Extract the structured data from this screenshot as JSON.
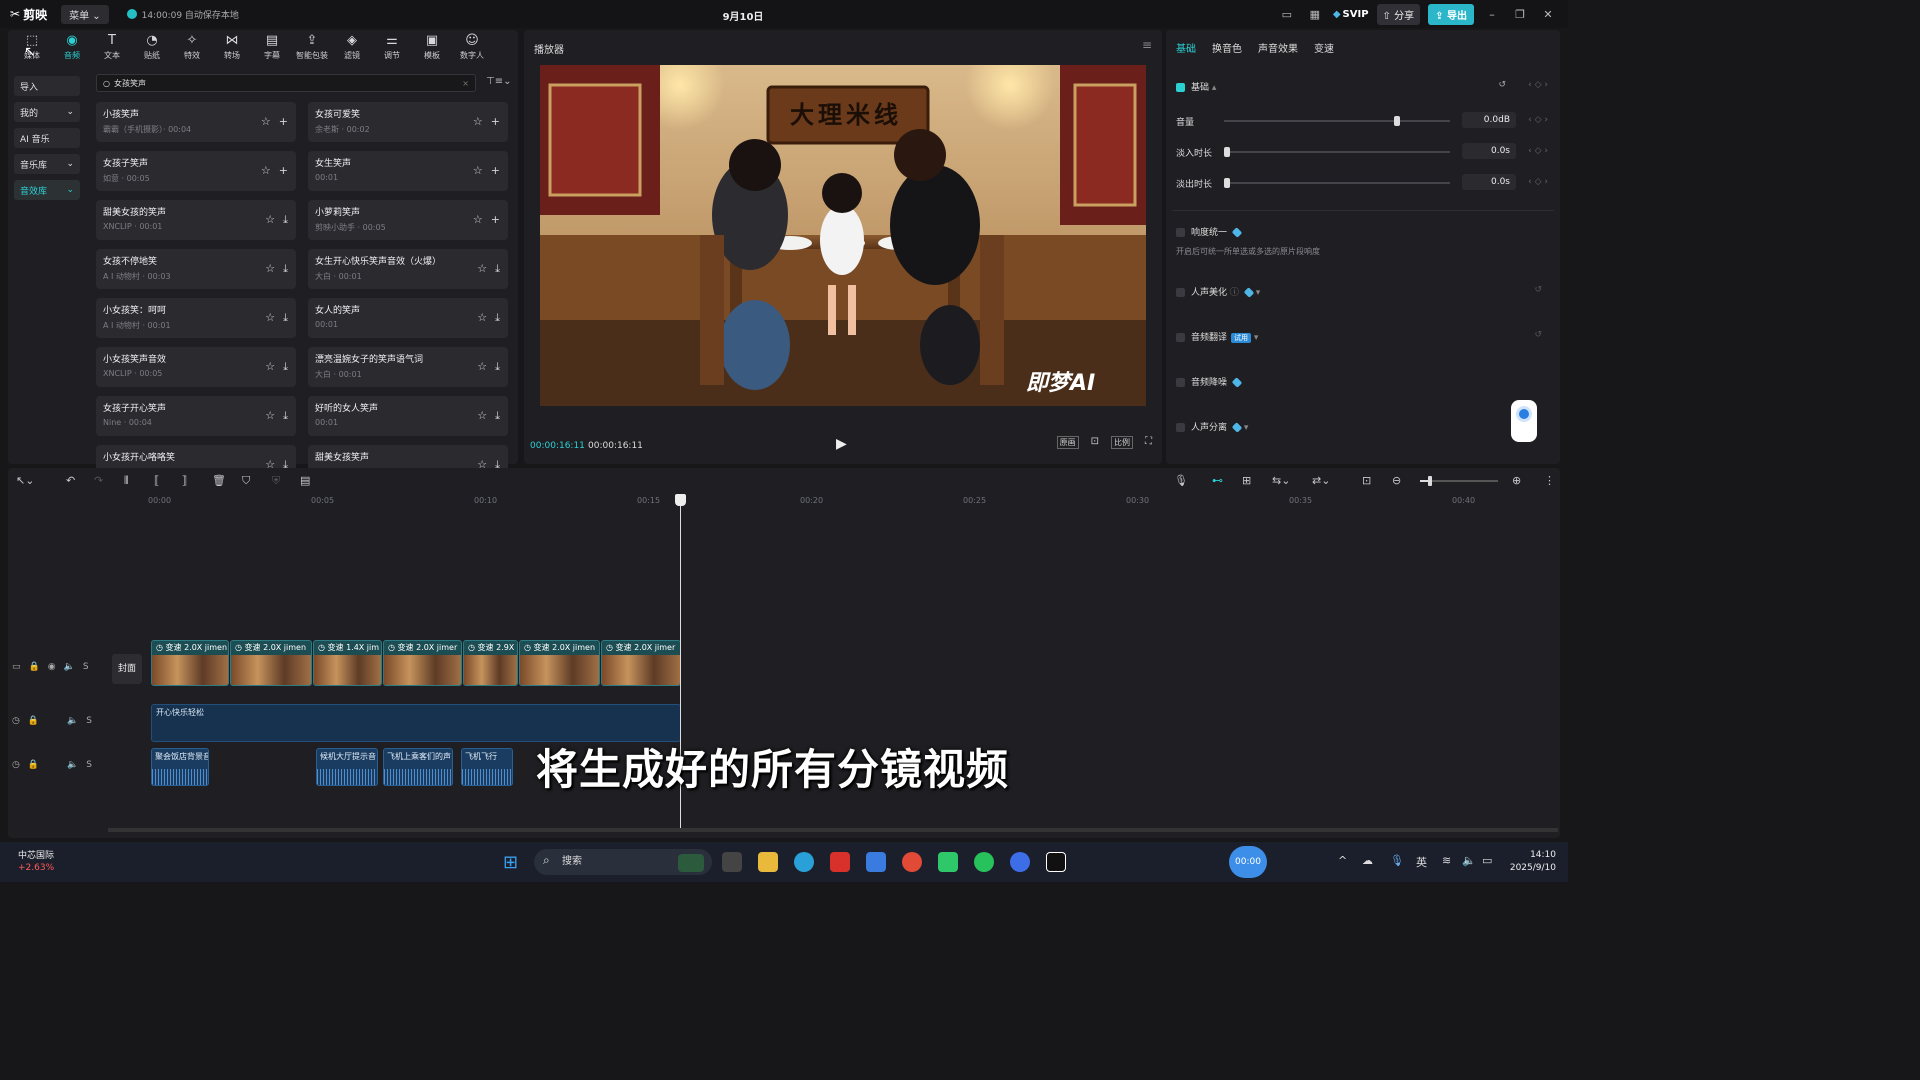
{
  "app": {
    "logo": "剪映",
    "menu": "菜单",
    "autosave": "14:00:09 自动保存本地",
    "date_title": "9月10日"
  },
  "topright": {
    "svip": "SVIP",
    "share": "分享",
    "export": "导出",
    "minimize": "–",
    "restore": "❐",
    "close": "✕"
  },
  "tools": [
    {
      "label": "媒体",
      "icon": "⬚"
    },
    {
      "label": "音频",
      "icon": "◉"
    },
    {
      "label": "文本",
      "icon": "T"
    },
    {
      "label": "贴纸",
      "icon": "◔"
    },
    {
      "label": "特效",
      "icon": "✧"
    },
    {
      "label": "转场",
      "icon": "⋈"
    },
    {
      "label": "字幕",
      "icon": "▤"
    },
    {
      "label": "智能包装",
      "icon": "⇪"
    },
    {
      "label": "滤镜",
      "icon": "◈"
    },
    {
      "label": "调节",
      "icon": "⚌"
    },
    {
      "label": "模板",
      "icon": "▣"
    },
    {
      "label": "数字人",
      "icon": "☺"
    }
  ],
  "sidebar": [
    {
      "label": "导入",
      "arrow": ""
    },
    {
      "label": "我的",
      "arrow": "⌄"
    },
    {
      "label": "AI 音乐",
      "arrow": ""
    },
    {
      "label": "音乐库",
      "arrow": "⌄"
    },
    {
      "label": "音效库",
      "arrow": "⌄"
    }
  ],
  "search": {
    "value": "女孩笑声",
    "clear": "×",
    "filter": "⊤≡⌄"
  },
  "cards": [
    {
      "title": "小孩笑声",
      "meta": "霸霸（手机摄影）· 00:04",
      "a2": "+"
    },
    {
      "title": "女孩可爱笑",
      "meta": "余老斯 · 00:02",
      "a2": "+"
    },
    {
      "title": "女孩子笑声",
      "meta": "如意 · 00:05",
      "a2": "+"
    },
    {
      "title": "女生笑声",
      "meta": "00:01",
      "a2": "+"
    },
    {
      "title": "甜美女孩的笑声",
      "meta": "XNCLIP · 00:01",
      "a2": "⤓"
    },
    {
      "title": "小萝莉笑声",
      "meta": "剪映小助手 · 00:05",
      "a2": "+"
    },
    {
      "title": "女孩不停地笑",
      "meta": "A I 动物村 · 00:03",
      "a2": "⤓"
    },
    {
      "title": "女生开心快乐笑声音效（火爆）",
      "meta": "大白 · 00:01",
      "a2": "⤓"
    },
    {
      "title": "小女孩笑：呵呵",
      "meta": "A I 动物村 · 00:01",
      "a2": "⤓"
    },
    {
      "title": "女人的笑声",
      "meta": "00:01",
      "a2": "⤓"
    },
    {
      "title": "小女孩笑声音效",
      "meta": "XNCLIP · 00:05",
      "a2": "⤓"
    },
    {
      "title": "漂亮温婉女子的笑声语气词",
      "meta": "大白 · 00:01",
      "a2": "⤓"
    },
    {
      "title": "女孩子开心笑声",
      "meta": "Nine · 00:04",
      "a2": "⤓"
    },
    {
      "title": "好听的女人笑声",
      "meta": "00:01",
      "a2": "⤓"
    },
    {
      "title": "小女孩开心咯咯笑",
      "meta": "",
      "a2": "⤓"
    },
    {
      "title": "甜美女孩笑声",
      "meta": "",
      "a2": "⤓"
    }
  ],
  "player": {
    "title": "播放器",
    "menu": "≡",
    "sign": "大理米线",
    "watermark": "即梦AI",
    "current_time": "00:00:16:11",
    "total_time": "00:00:16:11",
    "play": "▶",
    "btn_quality": "原画",
    "btn_focus": "⊡",
    "btn_ratio": "比例",
    "btn_full": "⛶"
  },
  "props": {
    "tabs": [
      "基础",
      "换音色",
      "声音效果",
      "变速"
    ],
    "basic_label": "基础",
    "reset": "↺",
    "keyframe": "‹ ◇ ›",
    "volume": {
      "label": "音量",
      "value": "0.0dB",
      "level": 0.75
    },
    "fadein": {
      "label": "淡入时长",
      "value": "0.0s",
      "level": 0
    },
    "fadeout": {
      "label": "淡出时长",
      "value": "0.0s",
      "level": 0
    },
    "loudness": {
      "label": "响度统一",
      "desc": "开启后可统一所单选或多选的原片段响度"
    },
    "enhance": {
      "label": "人声美化"
    },
    "translate": {
      "label": "音频翻译",
      "badge": "试用"
    },
    "denoise": {
      "label": "音频降噪"
    },
    "separate": {
      "label": "人声分离"
    }
  },
  "timeline": {
    "ticks": [
      "00:00",
      "00:05",
      "00:10",
      "00:15",
      "00:20",
      "00:25",
      "00:30",
      "00:35",
      "00:40"
    ],
    "cover": "封面",
    "clips": [
      {
        "label": "◷ 变速 2.0X  jimen"
      },
      {
        "label": "◷ 变速 2.0X  jimen"
      },
      {
        "label": "◷ 变速 1.4X  jim"
      },
      {
        "label": "◷ 变速 2.0X  jimer"
      },
      {
        "label": "◷ 变速 2.9X"
      },
      {
        "label": "◷ 变速 2.0X  jimen"
      },
      {
        "label": "◷ 变速 2.0X  jimer"
      }
    ],
    "music": "开心快乐轻松",
    "sfx": [
      {
        "label": "聚会饭店背景音"
      },
      {
        "label": "候机大厅提示音"
      },
      {
        "label": "飞机上乘客们的声"
      },
      {
        "label": "飞机飞行"
      }
    ]
  },
  "subtitle": "将生成好的所有分镜视频",
  "taskbar": {
    "stock_name": "中芯国际",
    "stock_change": "+2.63%",
    "search": "搜索",
    "recorder": "00:00",
    "ime": "英",
    "time": "14:10",
    "date": "2025/9/10"
  }
}
